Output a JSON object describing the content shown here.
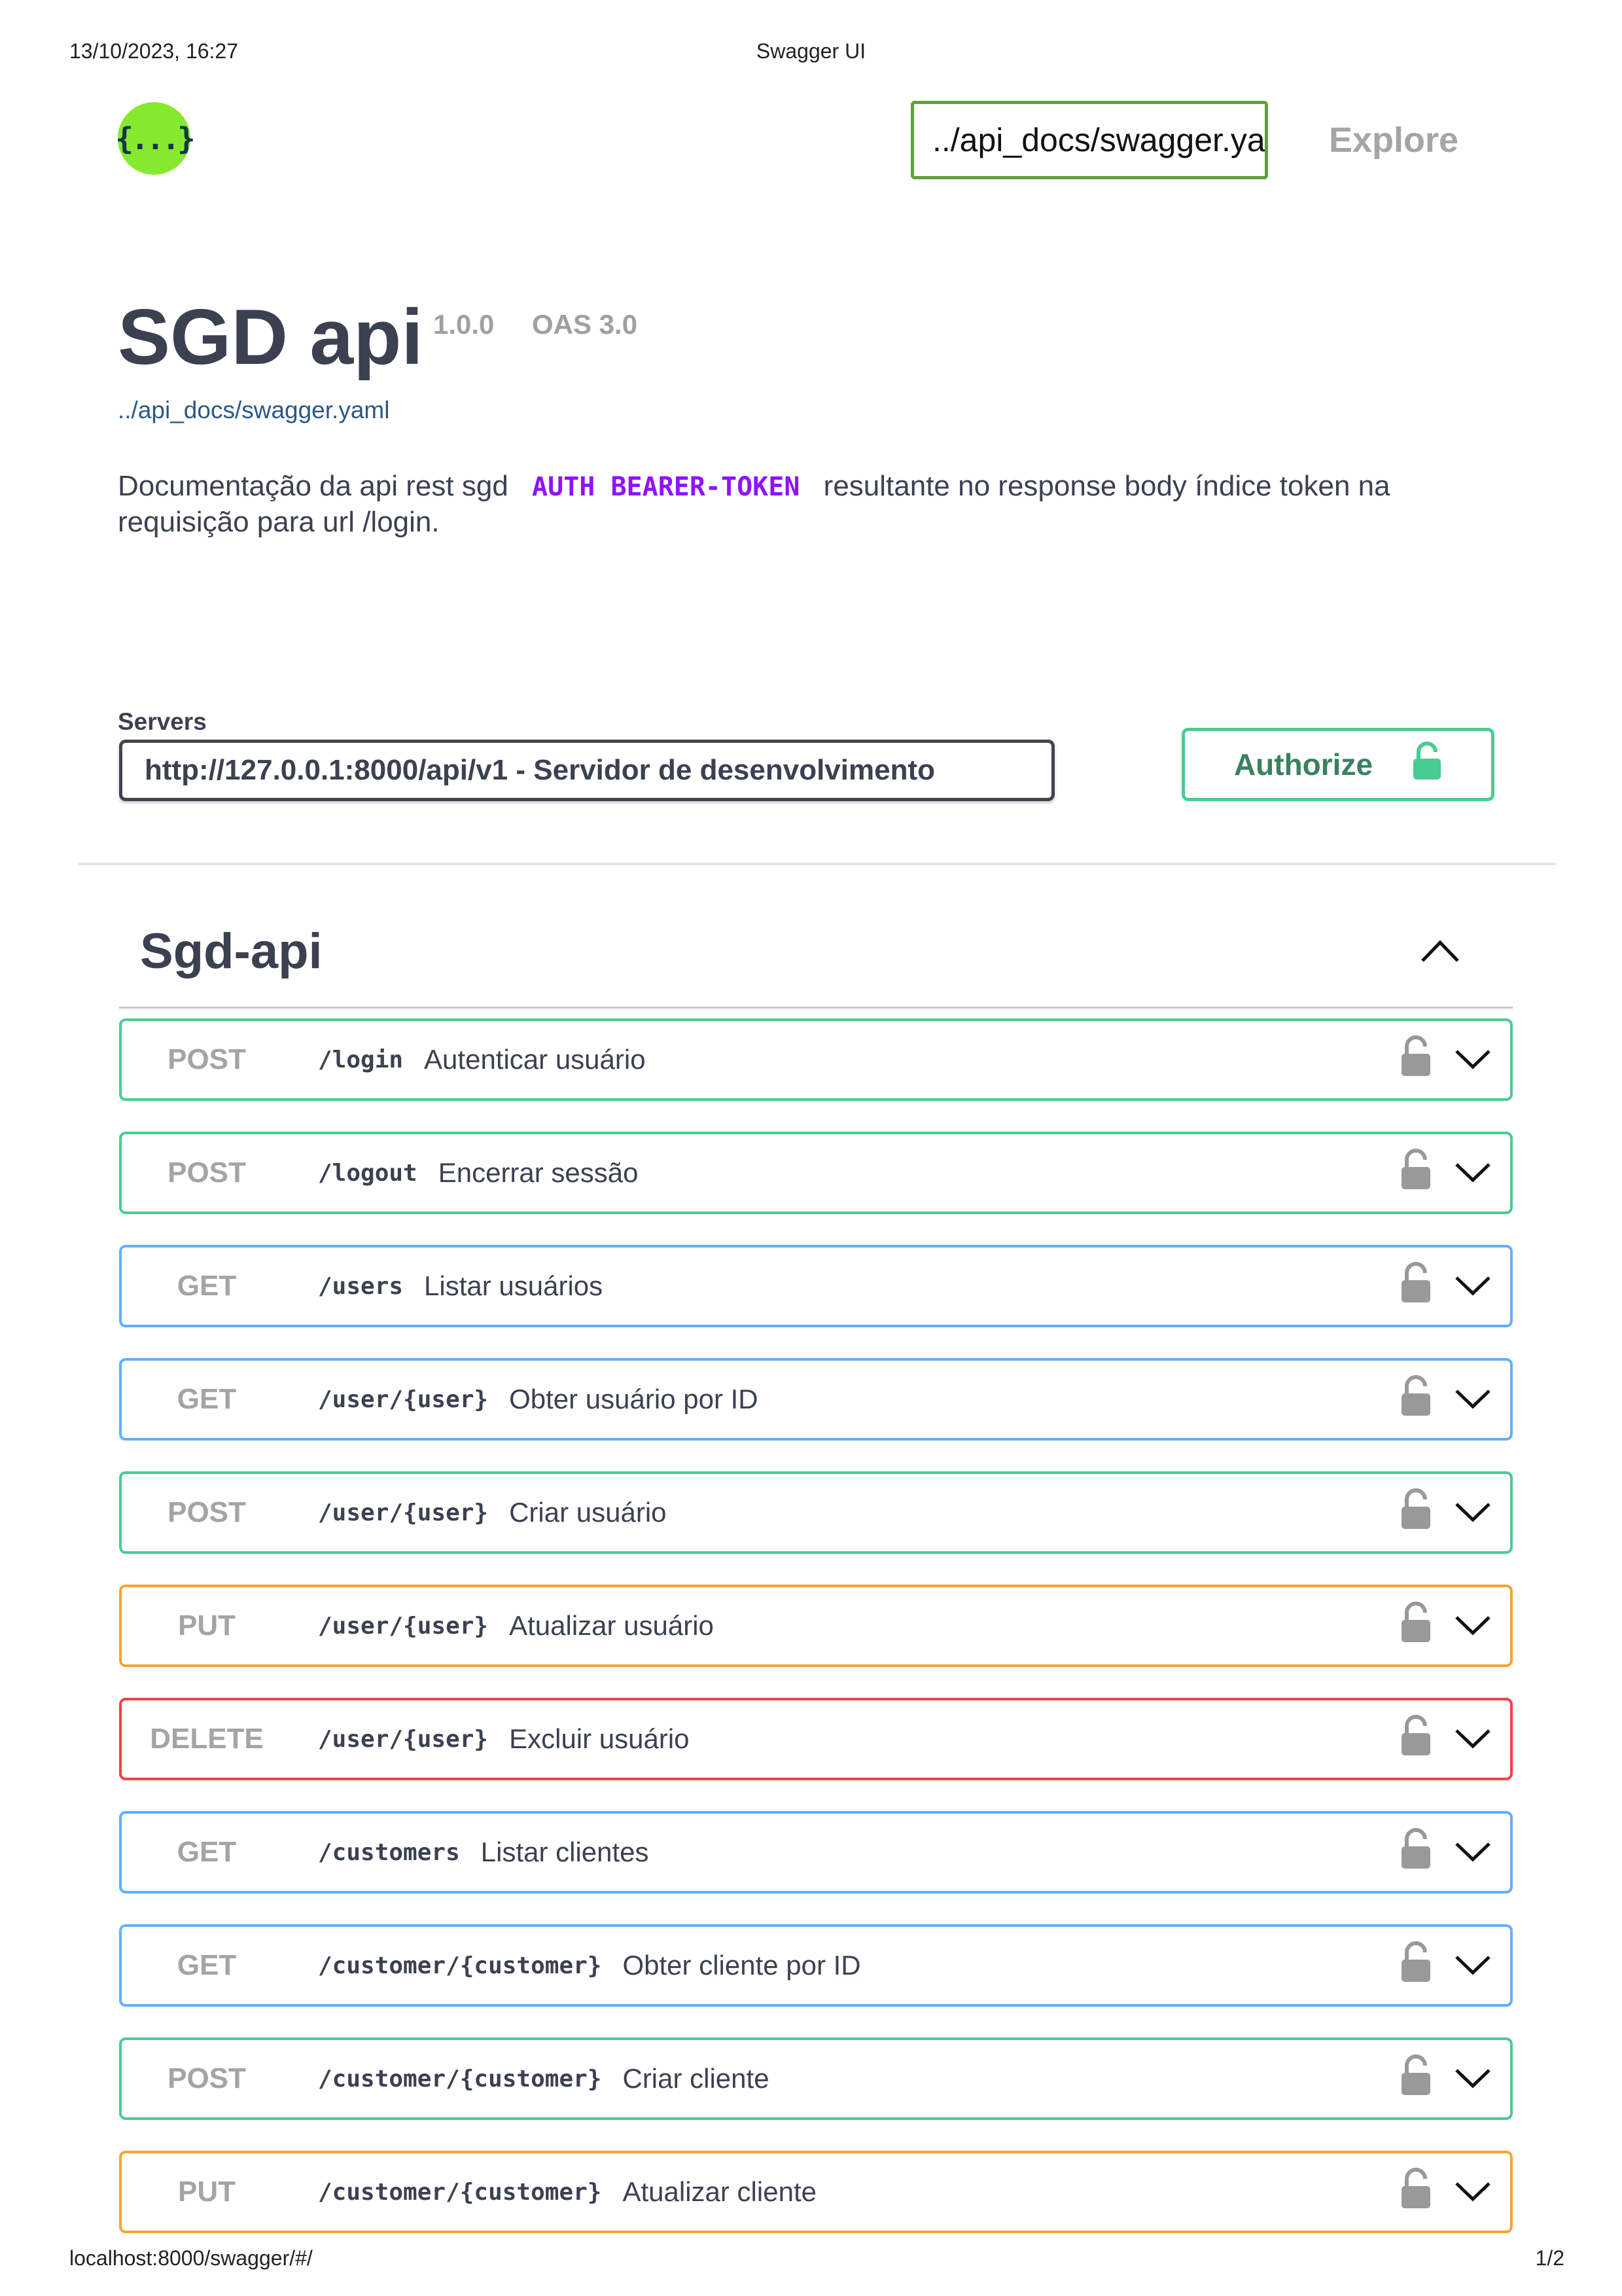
{
  "print": {
    "datetime": "13/10/2023, 16:27",
    "doc_title": "Swagger UI",
    "footer_url": "localhost:8000/swagger/#/",
    "page_number": "1/2"
  },
  "topbar": {
    "logo_glyph": "{...}",
    "url_value": "../api_docs/swagger.yaml",
    "explore_label": "Explore",
    "brand_color": "#85ea2d"
  },
  "info": {
    "title": "SGD api",
    "version": "1.0.0",
    "oas": "OAS 3.0",
    "spec_link": "../api_docs/swagger.yaml",
    "description_before": "Documentação da api rest sgd",
    "description_code": "AUTH BEARER-TOKEN",
    "description_after": "resultante no response body índice token na requisição para url /login."
  },
  "servers": {
    "label": "Servers",
    "selected": "http://127.0.0.1:8000/api/v1 - Servidor de desenvolvimento"
  },
  "authorize": {
    "label": "Authorize",
    "lock_icon": "unlocked-lock-icon"
  },
  "tag": {
    "name": "Sgd-api",
    "expanded": true
  },
  "method_colors": {
    "post": "#49cc90",
    "get": "#61affe",
    "put": "#fca130",
    "delete": "#f93e3e"
  },
  "operations": [
    {
      "method": "POST",
      "path": "/login",
      "summary": "Autenticar usuário"
    },
    {
      "method": "POST",
      "path": "/logout",
      "summary": "Encerrar sessão"
    },
    {
      "method": "GET",
      "path": "/users",
      "summary": "Listar usuários"
    },
    {
      "method": "GET",
      "path": "/user/{user}",
      "summary": "Obter usuário por ID"
    },
    {
      "method": "POST",
      "path": "/user/{user}",
      "summary": "Criar usuário"
    },
    {
      "method": "PUT",
      "path": "/user/{user}",
      "summary": "Atualizar usuário"
    },
    {
      "method": "DELETE",
      "path": "/user/{user}",
      "summary": "Excluir usuário"
    },
    {
      "method": "GET",
      "path": "/customers",
      "summary": "Listar clientes"
    },
    {
      "method": "GET",
      "path": "/customer/{customer}",
      "summary": "Obter cliente por ID"
    },
    {
      "method": "POST",
      "path": "/customer/{customer}",
      "summary": "Criar cliente"
    },
    {
      "method": "PUT",
      "path": "/customer/{customer}",
      "summary": "Atualizar cliente"
    }
  ]
}
